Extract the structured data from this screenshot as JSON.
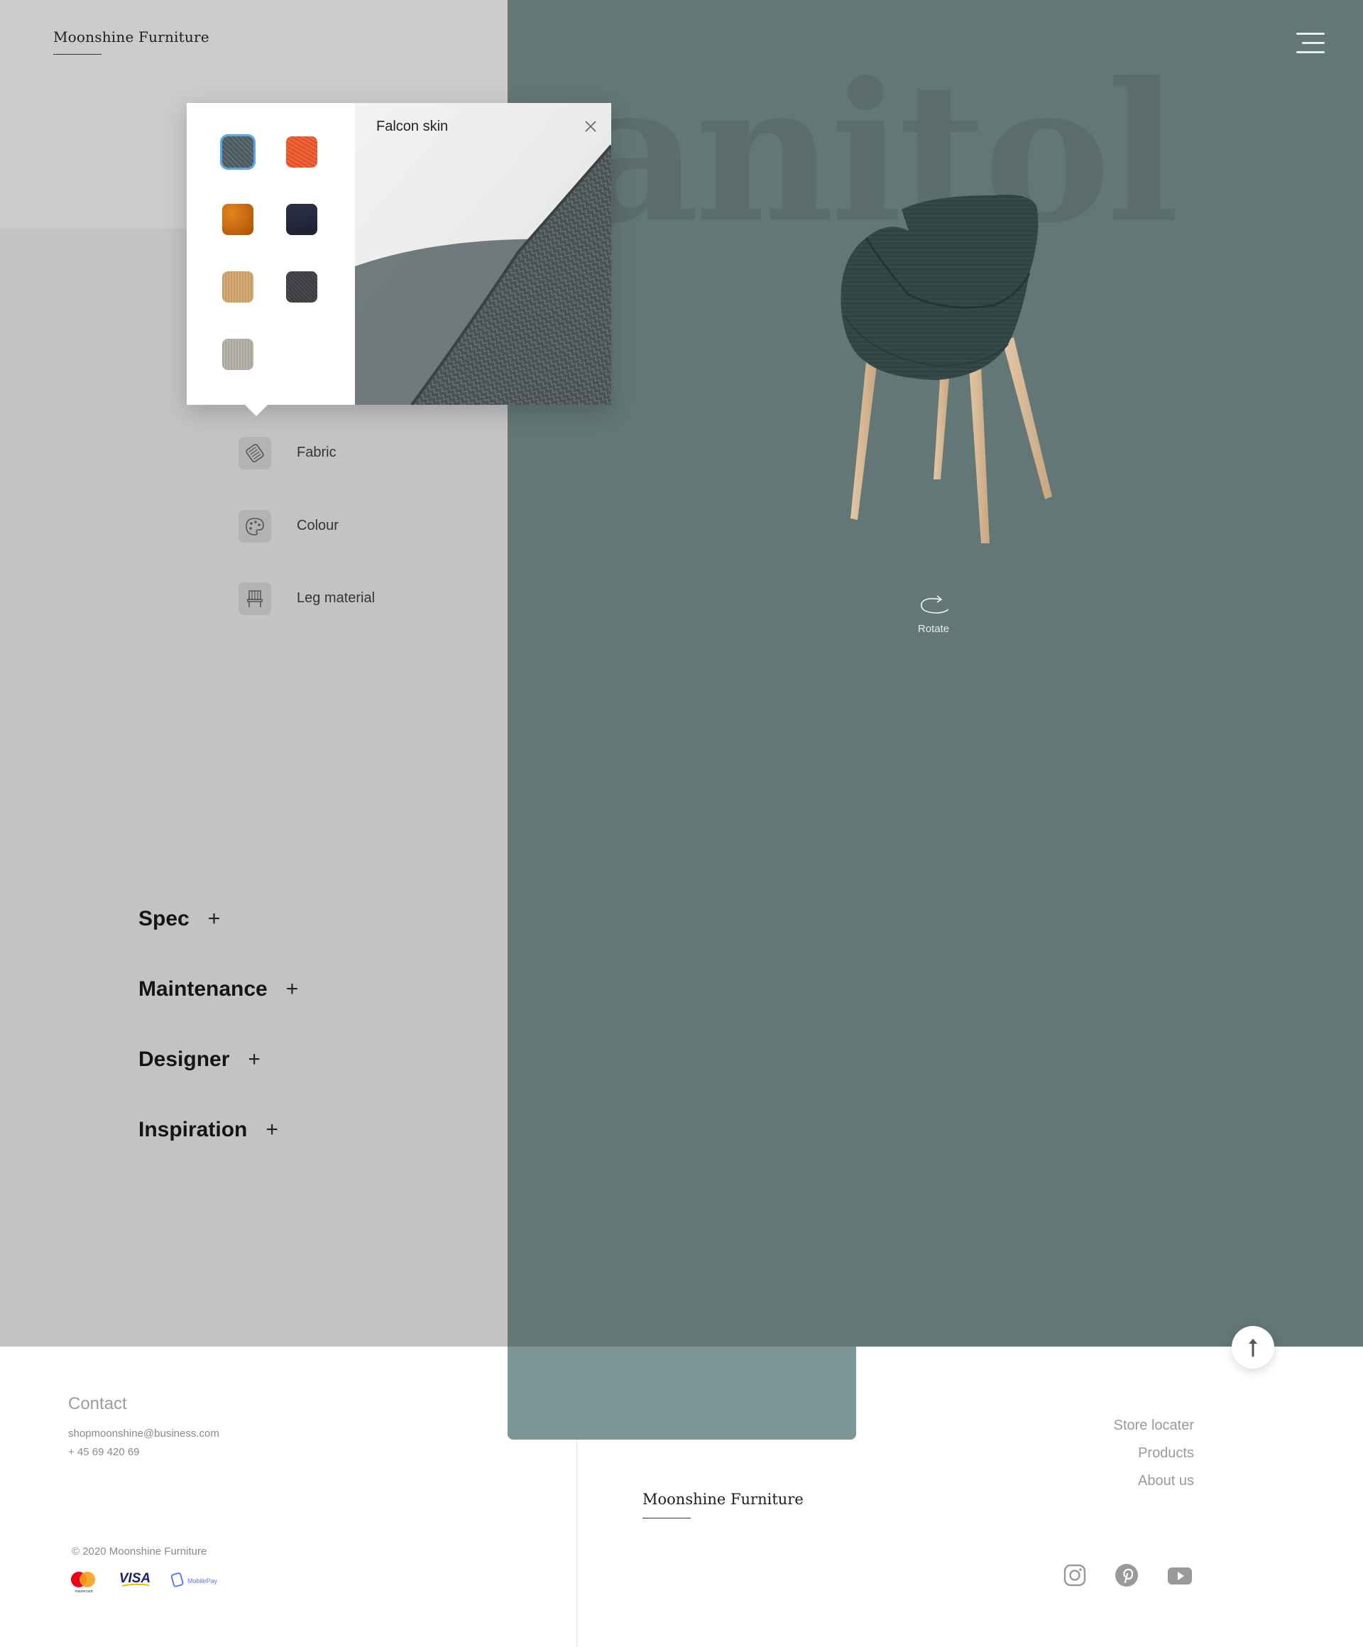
{
  "header": {
    "brand": "Moonshine Furniture",
    "menu_icon": "hamburger-menu-icon"
  },
  "hero": {
    "background_word": "anitol",
    "rotate_label": "Rotate"
  },
  "fabric_popup": {
    "title": "Falcon skin",
    "close_icon": "close-icon",
    "swatches": [
      {
        "name": "grey-blue-weave",
        "color": "#4b5a5f",
        "selected": true
      },
      {
        "name": "orange-red",
        "color": "#e4522c",
        "selected": false
      },
      {
        "name": "burnt-orange",
        "color": "#c7650f",
        "selected": false
      },
      {
        "name": "navy",
        "color": "#262b3d",
        "selected": false
      },
      {
        "name": "tan",
        "color": "#c79a63",
        "selected": false
      },
      {
        "name": "charcoal",
        "color": "#3a3b3e",
        "selected": false
      },
      {
        "name": "beige-grey",
        "color": "#a9a498",
        "selected": false
      }
    ]
  },
  "options": [
    {
      "label": "Fabric",
      "icon": "fabric-icon"
    },
    {
      "label": "Colour",
      "icon": "palette-icon"
    },
    {
      "label": "Leg material",
      "icon": "chair-icon"
    }
  ],
  "accordion": [
    {
      "label": "Spec",
      "icon": "plus-icon"
    },
    {
      "label": "Maintenance",
      "icon": "plus-icon"
    },
    {
      "label": "Designer",
      "icon": "plus-icon"
    },
    {
      "label": "Inspiration",
      "icon": "plus-icon"
    }
  ],
  "footer": {
    "contact_title": "Contact",
    "email": "shopmoonshine@business.com",
    "phone": "+ 45 69 420 69",
    "copyright": "© 2020 Moonshine Furniture",
    "payment_methods": [
      {
        "name": "mastercard-logo",
        "text": "mastercard"
      },
      {
        "name": "visa-logo",
        "text": "VISA"
      },
      {
        "name": "mobilepay-logo",
        "text": "MobilePay"
      }
    ],
    "brand": "Moonshine Furniture",
    "links": [
      "Store locater",
      "Products",
      "About us"
    ],
    "social": [
      "instagram-icon",
      "pinterest-icon",
      "youtube-icon"
    ]
  },
  "colors": {
    "left_panel": "#c3c3c3",
    "right_panel": "#637776",
    "footer_tab": "#7b9694",
    "selected_swatch_outline": "#5aa6e6"
  }
}
